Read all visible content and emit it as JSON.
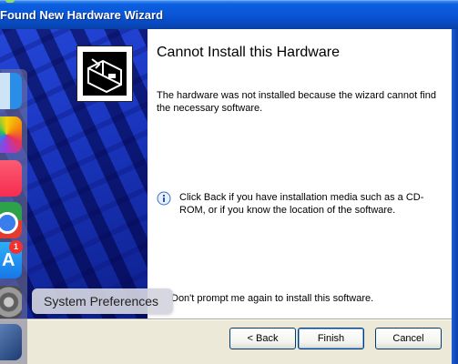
{
  "window": {
    "title": "Found New Hardware Wizard"
  },
  "content": {
    "heading": "Cannot Install this Hardware",
    "message": "The hardware was not installed because the wizard cannot find the necessary software.",
    "info": "Click Back if you have installation media such as a CD-ROM, or if you know the location of the software.",
    "checkbox_label": "Don't prompt me again to install this software."
  },
  "buttons": {
    "back": "< Back",
    "finish": "Finish",
    "cancel": "Cancel"
  },
  "dock": {
    "tooltip": "System Preferences",
    "app_store_badge": "1",
    "icons": [
      "finder-icon",
      "photos-icon",
      "music-icon",
      "chrome-icon",
      "app-store-icon",
      "system-preferences-icon",
      "virtualbox-icon"
    ]
  },
  "colors": {
    "title_bar": "#0a55d6",
    "left_panel": "#1a36bf",
    "dock_badge": "#f2302c"
  }
}
